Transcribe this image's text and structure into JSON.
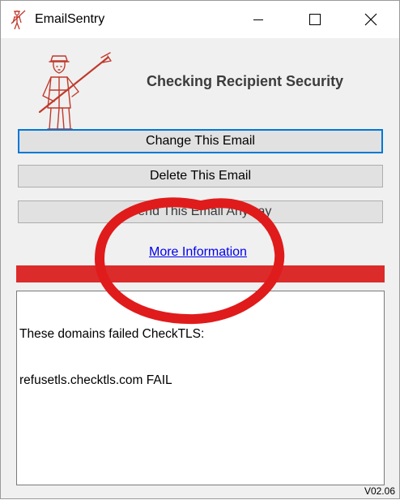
{
  "window": {
    "title": "EmailSentry",
    "icon": "soldier-logo-icon",
    "controls": [
      "minimize-icon",
      "maximize-icon",
      "close-icon"
    ]
  },
  "header": {
    "heading": "Checking Recipient Security",
    "logo": "soldier-logo-icon"
  },
  "buttons": {
    "change": "Change This Email",
    "delete": "Delete This Email",
    "send": "Send This Email Anyway"
  },
  "link": {
    "more_info": "More Information"
  },
  "status": {
    "color": "#dc2b2b"
  },
  "results": {
    "lines": [
      "These domains failed CheckTLS:",
      "refusetls.checktls.com FAIL"
    ]
  },
  "footer": {
    "version": "V02.06"
  },
  "annotation": {
    "color": "#e01b1b",
    "shape": "hand-drawn-circle"
  }
}
